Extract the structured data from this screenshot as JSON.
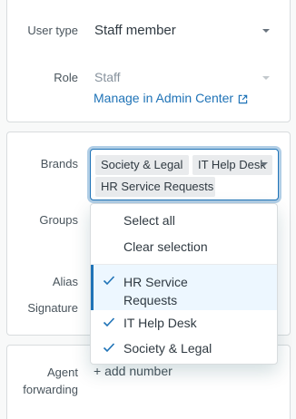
{
  "user_type": {
    "label": "User type",
    "value": "Staff member"
  },
  "role": {
    "label": "Role",
    "value": "Staff",
    "link": "Manage in Admin Center"
  },
  "brands": {
    "label": "Brands",
    "tags": [
      "Society & Legal",
      "IT Help Desk",
      "HR Service Requests"
    ]
  },
  "groups": {
    "label": "Groups"
  },
  "alias": {
    "label": "Alias"
  },
  "signature": {
    "label": "Signature"
  },
  "dropdown": {
    "select_all": "Select all",
    "clear_selection": "Clear selection",
    "options": [
      {
        "line1": "HR Service",
        "line2": "Requests",
        "checked": true,
        "highlighted": true
      },
      {
        "line1": "IT Help Desk",
        "checked": true
      },
      {
        "line1": "Society & Legal",
        "checked": true
      }
    ]
  },
  "agent_forwarding": {
    "label_line1": "Agent",
    "label_line2": "forwarding",
    "action": "+ add number"
  },
  "colors": {
    "accent": "#1f73b7",
    "highlight": "#edf7ff",
    "tag_bg": "#e9ebed"
  }
}
